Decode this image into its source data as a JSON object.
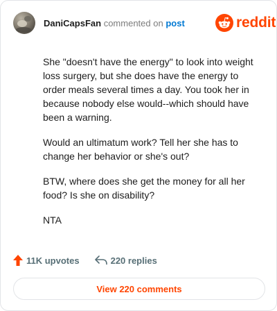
{
  "header": {
    "username": "DaniCapsFan",
    "action": "commented on",
    "post_link": "post"
  },
  "logo": {
    "wordmark": "reddit",
    "brand_color": "#ff4500",
    "icon": "reddit-snoo-icon"
  },
  "comment": {
    "paragraphs": [
      "She \"doesn't have the energy\" to look into weight loss surgery, but she does have the energy to order meals several times a day. You took her in because nobody else would--which should have been a warning.",
      "Would an ultimatum work? Tell her she has to change her behavior or she's out?",
      "BTW, where does she get the money for all her food? Is she on disability?",
      "NTA"
    ]
  },
  "footer": {
    "upvotes": "11K upvotes",
    "upvote_icon": "upvote-arrow-icon",
    "upvote_color": "#ff4500",
    "replies": "220 replies",
    "reply_icon": "reply-arrow-icon"
  },
  "view_comments": {
    "label": "View 220 comments"
  }
}
